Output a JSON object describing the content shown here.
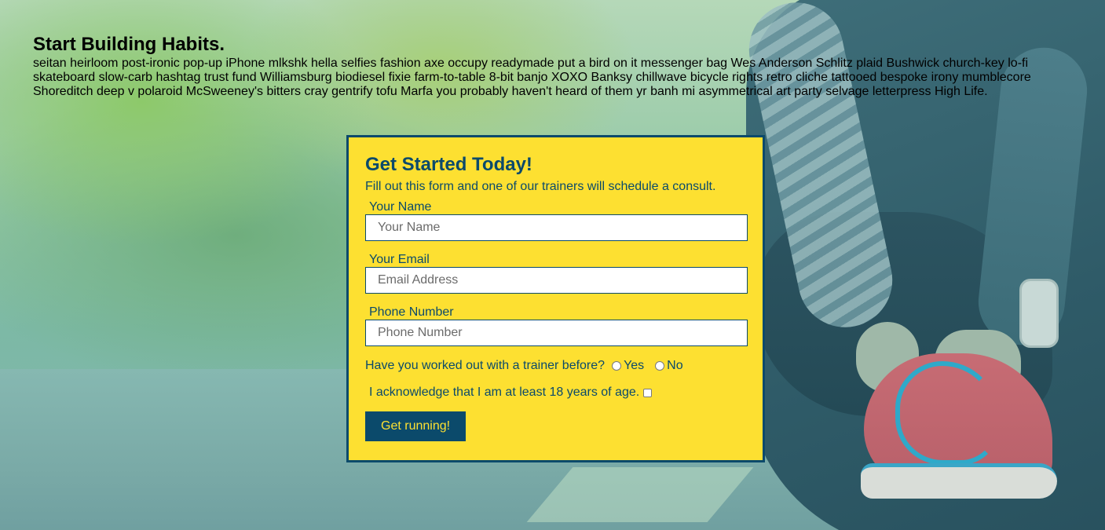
{
  "intro": {
    "title": "Start Building Habits.",
    "body": "seitan heirloom post-ironic pop-up iPhone mlkshk hella selfies fashion axe occupy readymade put a bird on it messenger bag Wes Anderson Schlitz plaid Bushwick church-key lo-fi skateboard slow-carb hashtag trust fund Williamsburg biodiesel fixie farm-to-table 8-bit banjo XOXO Banksy chillwave bicycle rights retro cliche tattooed bespoke irony mumblecore Shoreditch deep v polaroid McSweeney's bitters cray gentrify tofu Marfa you probably haven't heard of them yr banh mi asymmetrical art party selvage letterpress High Life."
  },
  "form": {
    "title": "Get Started Today!",
    "subtitle": "Fill out this form and one of our trainers will schedule a consult.",
    "name_label": "Your Name",
    "name_placeholder": "Your Name",
    "name_value": "",
    "email_label": "Your Email",
    "email_placeholder": "Email Address",
    "email_value": "",
    "phone_label": "Phone Number",
    "phone_placeholder": "Phone Number",
    "phone_value": "",
    "trainer_question": "Have you worked out with a trainer before?",
    "trainer_options": [
      "Yes",
      "No"
    ],
    "age_ack": "I acknowledge that I am at least 18 years of age.",
    "submit_label": "Get running!"
  },
  "colors": {
    "card_background": "#fde031",
    "brand_navy": "#0b4a6b",
    "button_text": "#fde031"
  }
}
